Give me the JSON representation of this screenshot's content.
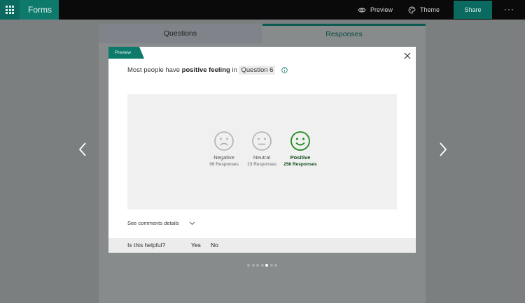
{
  "header": {
    "app_name": "Forms",
    "preview_label": "Preview",
    "theme_label": "Theme",
    "share_label": "Share",
    "more_label": "···"
  },
  "tabs": {
    "questions": "Questions",
    "responses": "Responses"
  },
  "modal": {
    "tag": "Preview",
    "headline_prefix": "Most people have",
    "headline_bold": "positive feeling",
    "headline_in": "in",
    "question_ref": "Question 6",
    "sentiments": [
      {
        "label": "Negative",
        "count": "96 Responses",
        "icon": "sad-face-icon",
        "color": "#b0b0b0"
      },
      {
        "label": "Neutral",
        "count": "23 Responses",
        "icon": "neutral-face-icon",
        "color": "#b0b0b0"
      },
      {
        "label": "Positive",
        "count": "256 Responses",
        "icon": "happy-face-icon",
        "color": "#1f8a1f"
      }
    ],
    "comments_label": "See comments details",
    "helpful_question": "Is this helpful?",
    "yes": "Yes",
    "no": "No"
  },
  "pagination": {
    "total": 7,
    "current": 5
  },
  "colors": {
    "accent": "#0d7a6c",
    "positive": "#1f8a1f",
    "overlay": "#7b7f7f"
  }
}
